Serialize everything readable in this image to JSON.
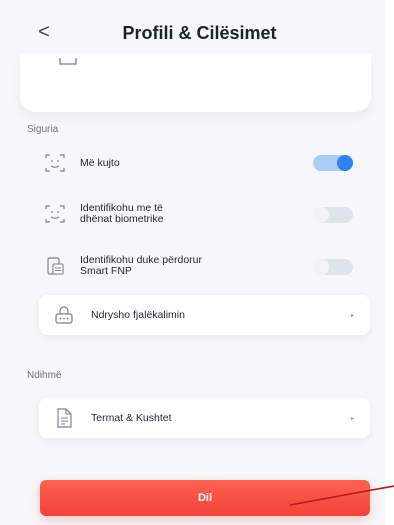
{
  "header": {
    "back_icon": "chevron-left-icon",
    "back_glyph": "<",
    "title": "Profili & Cilësimet"
  },
  "sections": {
    "security": {
      "label": "Siguria"
    },
    "help": {
      "label": "Ndihmë"
    }
  },
  "security_items": [
    {
      "label": "Më kujto",
      "icon": "face-scan-icon",
      "enabled": true
    },
    {
      "label_line1": "Identifikohu me të",
      "label_line2": "dhënat biometrike",
      "icon": "face-scan-icon",
      "enabled": false
    },
    {
      "label_line1": "Identifikohu duke përdorur",
      "label_line2": "Smart FNP",
      "icon": "device-id-icon",
      "enabled": false
    }
  ],
  "change_password": {
    "label": "Ndrysho fjalëkalimin",
    "icon": "password-icon",
    "arrow": "▸"
  },
  "terms": {
    "label": "Termat & Kushtet",
    "icon": "document-icon",
    "arrow": "▸"
  },
  "logout": {
    "label": "Dil"
  },
  "colors": {
    "accent": "#2b84f0",
    "danger": "#f04336",
    "annotation": "#c0161c"
  }
}
